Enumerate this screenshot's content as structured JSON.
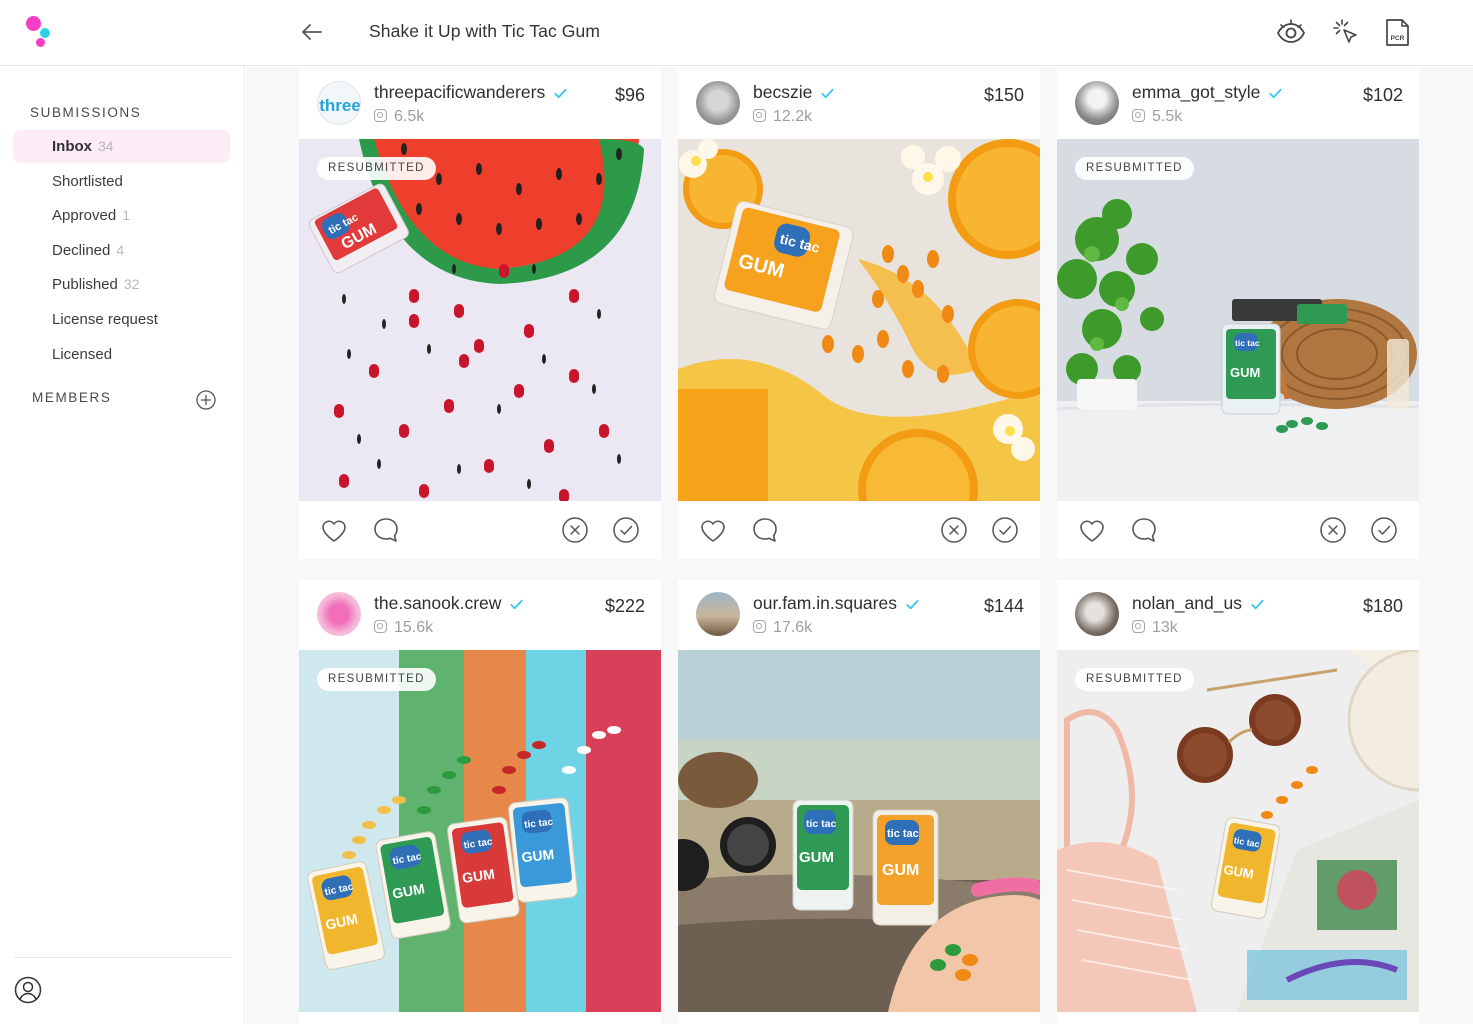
{
  "header": {
    "title": "Shake it Up with Tic Tac Gum",
    "icons": [
      "back-arrow-icon",
      "eye-icon",
      "cursor-click-icon",
      "pcr-document-icon"
    ],
    "pcr_label": "PCR"
  },
  "sidebar": {
    "submissions_title": "SUBMISSIONS",
    "members_title": "MEMBERS",
    "items": [
      {
        "label": "Inbox",
        "count": "34"
      },
      {
        "label": "Shortlisted",
        "count": ""
      },
      {
        "label": "Approved",
        "count": "1"
      },
      {
        "label": "Declined",
        "count": "4"
      },
      {
        "label": "Published",
        "count": "32"
      },
      {
        "label": "License request",
        "count": ""
      },
      {
        "label": "Licensed",
        "count": ""
      }
    ]
  },
  "colors": {
    "brand_pink": "#f23ec6",
    "brand_cyan": "#2ed2e6",
    "verified_blue": "#3ec5e8",
    "active_nav_bg": "#fdebf5"
  },
  "cards": [
    {
      "username": "threepacificwanderers",
      "followers": "6.5k",
      "price": "$96",
      "badge": "RESUBMITTED",
      "avatar_text": "three"
    },
    {
      "username": "becszie",
      "followers": "12.2k",
      "price": "$150",
      "badge": ""
    },
    {
      "username": "emma_got_style",
      "followers": "5.5k",
      "price": "$102",
      "badge": "RESUBMITTED"
    },
    {
      "username": "the.sanook.crew",
      "followers": "15.6k",
      "price": "$222",
      "badge": "RESUBMITTED"
    },
    {
      "username": "our.fam.in.squares",
      "followers": "17.6k",
      "price": "$144",
      "badge": ""
    },
    {
      "username": "nolan_and_us",
      "followers": "13k",
      "price": "$180",
      "badge": "RESUBMITTED"
    }
  ],
  "product_labels": {
    "brand": "tic tac",
    "gum": "GUM"
  }
}
